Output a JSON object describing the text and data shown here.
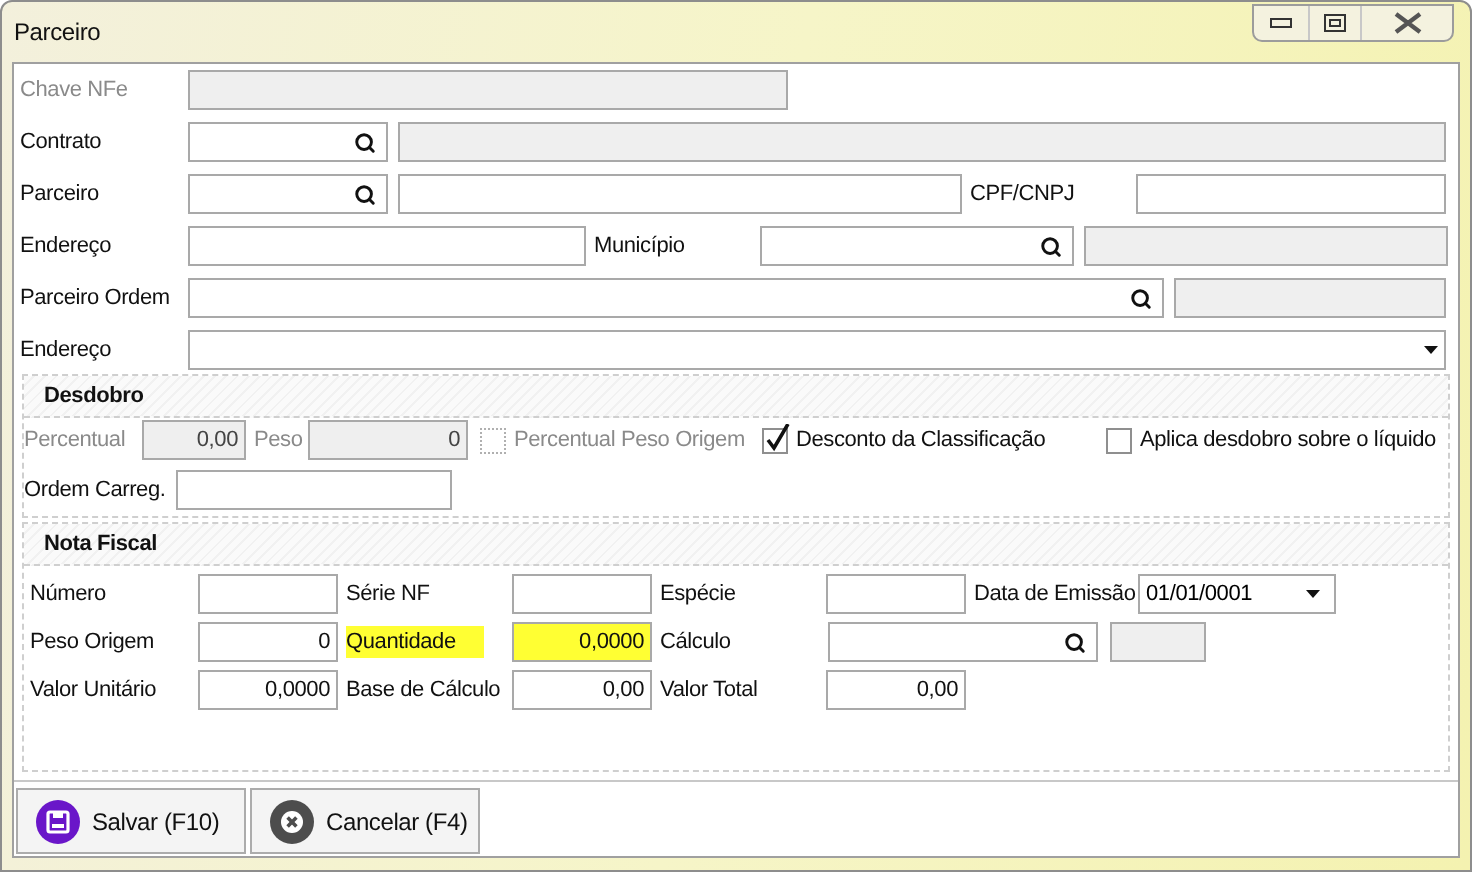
{
  "window": {
    "title": "Parceiro"
  },
  "main_rows": [
    [
      {
        "kind": "label",
        "text": "Chave NFe",
        "disabled": true
      },
      {
        "kind": "input",
        "disabled": true
      }
    ],
    [
      {
        "kind": "label",
        "text": "Contrato",
        "disabled": false
      },
      {
        "kind": "lookup",
        "disabled": false
      },
      {
        "kind": "input",
        "disabled": true
      }
    ],
    [
      {
        "kind": "label",
        "text": "Parceiro",
        "disabled": false
      },
      {
        "kind": "lookup",
        "disabled": false
      },
      {
        "kind": "input",
        "disabled": false
      },
      {
        "kind": "label",
        "text": "CPF/CNPJ",
        "disabled": false
      },
      {
        "kind": "input",
        "disabled": false
      }
    ],
    [
      {
        "kind": "label",
        "text": "Endereço",
        "disabled": false
      },
      {
        "kind": "input",
        "disabled": false
      },
      {
        "kind": "label",
        "text": "Município",
        "disabled": false
      },
      {
        "kind": "lookup",
        "disabled": false
      },
      {
        "kind": "input",
        "disabled": true
      }
    ],
    [
      {
        "kind": "label",
        "text": "Parceiro Ordem",
        "disabled": false
      },
      {
        "kind": "lookup",
        "disabled": false
      },
      {
        "kind": "input",
        "disabled": true
      }
    ],
    [
      {
        "kind": "label",
        "text": "Endereço",
        "disabled": false
      },
      {
        "kind": "select",
        "disabled": false
      }
    ]
  ],
  "desdobro": {
    "title": "Desdobro",
    "rows": [
      [
        {
          "kind": "label",
          "text": "Percentual",
          "disabled": true
        },
        {
          "kind": "number",
          "value": "0,00",
          "disabled": true
        },
        {
          "kind": "label",
          "text": "Peso",
          "disabled": true
        },
        {
          "kind": "number",
          "value": "0",
          "disabled": true
        },
        {
          "kind": "checkbox",
          "text": "Percentual Peso Origem",
          "checked": false,
          "disabled": true
        },
        {
          "kind": "checkbox",
          "text": "Desconto da Classificação",
          "checked": true,
          "disabled": false
        },
        {
          "kind": "checkbox",
          "text": "Aplica desdobro sobre o líquido",
          "checked": false,
          "disabled": false
        }
      ],
      [
        {
          "kind": "label",
          "text": "Ordem Carreg.",
          "disabled": false
        },
        {
          "kind": "input",
          "disabled": false
        }
      ]
    ]
  },
  "nota_fiscal": {
    "title": "Nota Fiscal",
    "rows": [
      [
        {
          "kind": "label",
          "text": "Número",
          "highlighted": false
        },
        {
          "kind": "input",
          "highlighted": false
        },
        {
          "kind": "label",
          "text": "Série NF",
          "highlighted": false
        },
        {
          "kind": "input",
          "highlighted": false
        },
        {
          "kind": "label",
          "text": "Espécie",
          "highlighted": false
        },
        {
          "kind": "input",
          "highlighted": false
        },
        {
          "kind": "label",
          "text": "Data de Emissão",
          "highlighted": false
        },
        {
          "kind": "date",
          "value": "01/01/0001",
          "highlighted": false
        }
      ],
      [
        {
          "kind": "label",
          "text": "Peso Origem",
          "highlighted": false
        },
        {
          "kind": "number",
          "value": "0",
          "highlighted": false
        },
        {
          "kind": "label",
          "text": "Quantidade",
          "highlighted": true
        },
        {
          "kind": "number",
          "value": "0,0000",
          "highlighted": true
        },
        {
          "kind": "label",
          "text": "Cálculo",
          "highlighted": false
        },
        {
          "kind": "lookup",
          "highlighted": false
        },
        {
          "kind": "input",
          "disabled": true,
          "highlighted": false
        }
      ],
      [
        {
          "kind": "label",
          "text": "Valor Unitário",
          "highlighted": false
        },
        {
          "kind": "number",
          "value": "0,0000",
          "highlighted": false
        },
        {
          "kind": "label",
          "text": "Base de Cálculo",
          "highlighted": false
        },
        {
          "kind": "number",
          "value": "0,00",
          "highlighted": false
        },
        {
          "kind": "label",
          "text": "Valor Total",
          "highlighted": false
        },
        {
          "kind": "number",
          "value": "0,00",
          "highlighted": false
        }
      ]
    ]
  },
  "buttons": [
    {
      "kind": "save",
      "label": "Salvar (F10)"
    },
    {
      "kind": "cancel",
      "label": "Cancelar (F4)"
    }
  ]
}
